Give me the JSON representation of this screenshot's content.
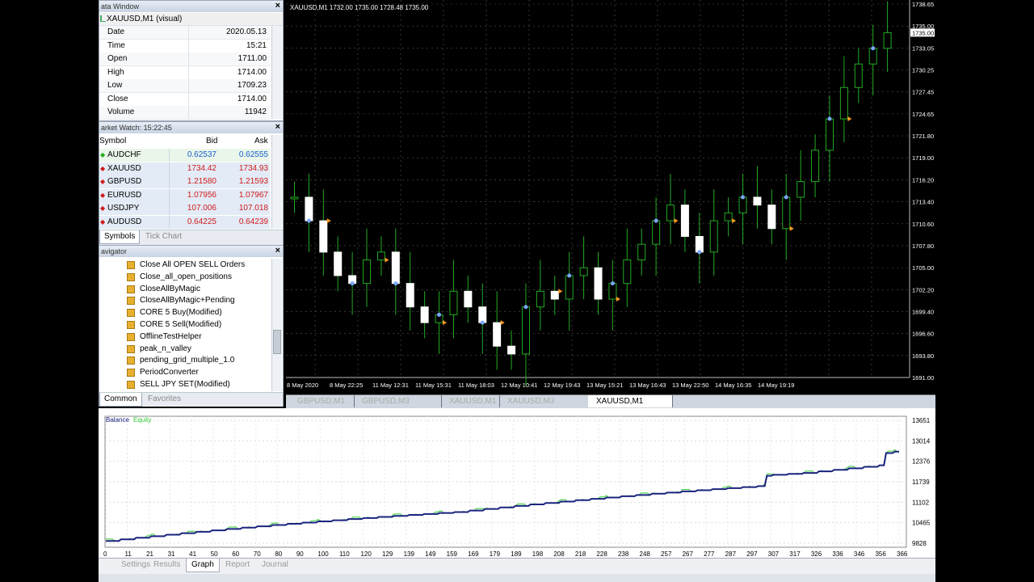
{
  "data_window": {
    "title": "ata Window",
    "symbol": "XAUUSD,M1 (visual)",
    "rows": [
      {
        "label": "Date",
        "value": "2020.05.13"
      },
      {
        "label": "Time",
        "value": "15:21"
      },
      {
        "label": "Open",
        "value": "1711.00"
      },
      {
        "label": "High",
        "value": "1714.00"
      },
      {
        "label": "Low",
        "value": "1709.23"
      },
      {
        "label": "Close",
        "value": "1714.00"
      },
      {
        "label": "Volume",
        "value": "11942"
      }
    ]
  },
  "market_watch": {
    "title": "arket Watch: 15:22:45",
    "headers": {
      "symbol": "Symbol",
      "bid": "Bid",
      "ask": "Ask"
    },
    "rows": [
      {
        "symbol": "AUDCHF",
        "bid": "0.62537",
        "ask": "0.62555",
        "color": "#1a5fd1"
      },
      {
        "symbol": "XAUUSD",
        "bid": "1734.42",
        "ask": "1734.93",
        "color": "#d11a1a"
      },
      {
        "symbol": "GBPUSD",
        "bid": "1.21580",
        "ask": "1.21593",
        "color": "#d11a1a"
      },
      {
        "symbol": "EURUSD",
        "bid": "1.07956",
        "ask": "1.07967",
        "color": "#d11a1a"
      },
      {
        "symbol": "USDJPY",
        "bid": "107.006",
        "ask": "107.018",
        "color": "#d11a1a"
      },
      {
        "symbol": "AUDUSD",
        "bid": "0.64225",
        "ask": "0.64239",
        "color": "#d11a1a"
      }
    ],
    "tabs": [
      "Symbols",
      "Tick Chart"
    ]
  },
  "navigator": {
    "title": "avigator",
    "items": [
      "Close All OPEN SELL Orders",
      "Close_all_open_positions",
      "CloseAllByMagic",
      "CloseAllByMagic+Pending",
      "CORE 5 Buy(Modified)",
      "CORE 5 Sell(Modified)",
      "OfflineTestHelper",
      "peak_n_valley",
      "pending_grid_multiple_1.0",
      "PeriodConverter",
      "SELL JPY SET(Modified)"
    ],
    "tabs": [
      "Common",
      "Favorites"
    ]
  },
  "chart": {
    "header": "XAUUSD,M1  1732.00 1735.00 1728.48 1735.00",
    "price_labels": [
      "1738.65",
      "1735.00",
      "1733.05",
      "1730.25",
      "1727.45",
      "1724.65",
      "1721.80",
      "1719.00",
      "1716.20",
      "1713.40",
      "1710.60",
      "1707.80",
      "1705.00",
      "1702.20",
      "1699.40",
      "1696.60",
      "1693.80",
      "1691.00"
    ],
    "time_labels": [
      "8 May 2020",
      "8 May 22:25",
      "11 May 12:31",
      "11 May 15:31",
      "11 May 18:03",
      "12 May 10:41",
      "12 May 19:43",
      "13 May 15:21",
      "13 May 16:43",
      "13 May 22:50",
      "14 May 16:35",
      "14 May 19:19"
    ],
    "tabs": [
      "GBPUSD,M1",
      "GBPUSD,M3 (offline)",
      "XAUUSD,M1",
      "XAUUSD,M3 (offline)",
      "XAUUSD,M1 (visual)"
    ],
    "bull_color": "#22aa22",
    "bear_color": "#ffffff"
  },
  "tester": {
    "legend_balance": "Balance",
    "legend_equity": "Equity",
    "balance_color": "#1a237e",
    "equity_color": "#33cc33",
    "y_labels": [
      "13651",
      "13014",
      "12376",
      "11739",
      "11102",
      "10465",
      "9828"
    ],
    "x_labels": [
      "0",
      "11",
      "21",
      "31",
      "41",
      "50",
      "60",
      "70",
      "80",
      "90",
      "100",
      "110",
      "120",
      "129",
      "139",
      "149",
      "159",
      "169",
      "179",
      "189",
      "198",
      "208",
      "218",
      "228",
      "238",
      "248",
      "257",
      "267",
      "277",
      "287",
      "297",
      "307",
      "317",
      "326",
      "336",
      "346",
      "356",
      "366"
    ],
    "tabs": [
      "Settings",
      "Results",
      "Graph",
      "Report",
      "Journal"
    ]
  }
}
